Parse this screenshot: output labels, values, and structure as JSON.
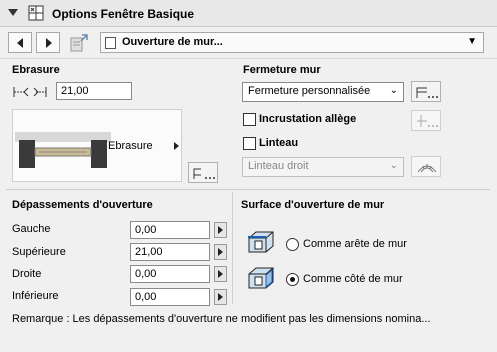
{
  "header": {
    "title": "Options Fenêtre Basique"
  },
  "nav": {
    "dropdown_label": "Ouverture de mur..."
  },
  "ebrasure": {
    "heading": "Ebrasure",
    "value": "21,00",
    "preview_label": "Ebrasure"
  },
  "fermeture": {
    "heading": "Fermeture mur",
    "select_value": "Fermeture personnalisée",
    "incrustation_label": "Incrustation allège",
    "incrustation_checked": false,
    "linteau_label": "Linteau",
    "linteau_checked": false,
    "linteau_select": "Linteau droit"
  },
  "depassements": {
    "heading": "Dépassements d'ouverture",
    "rows": [
      {
        "label": "Gauche",
        "value": "0,00"
      },
      {
        "label": "Supérieure",
        "value": "21,00"
      },
      {
        "label": "Droite",
        "value": "0,00"
      },
      {
        "label": "Inférieure",
        "value": "0,00"
      }
    ]
  },
  "surface": {
    "heading": "Surface d'ouverture de mur",
    "options": [
      {
        "label": "Comme arête de mur",
        "selected": false
      },
      {
        "label": "Comme côté de mur",
        "selected": true
      }
    ]
  },
  "remark": "Remarque : Les dépassements d'ouverture ne modifient pas les dimensions nomina..."
}
